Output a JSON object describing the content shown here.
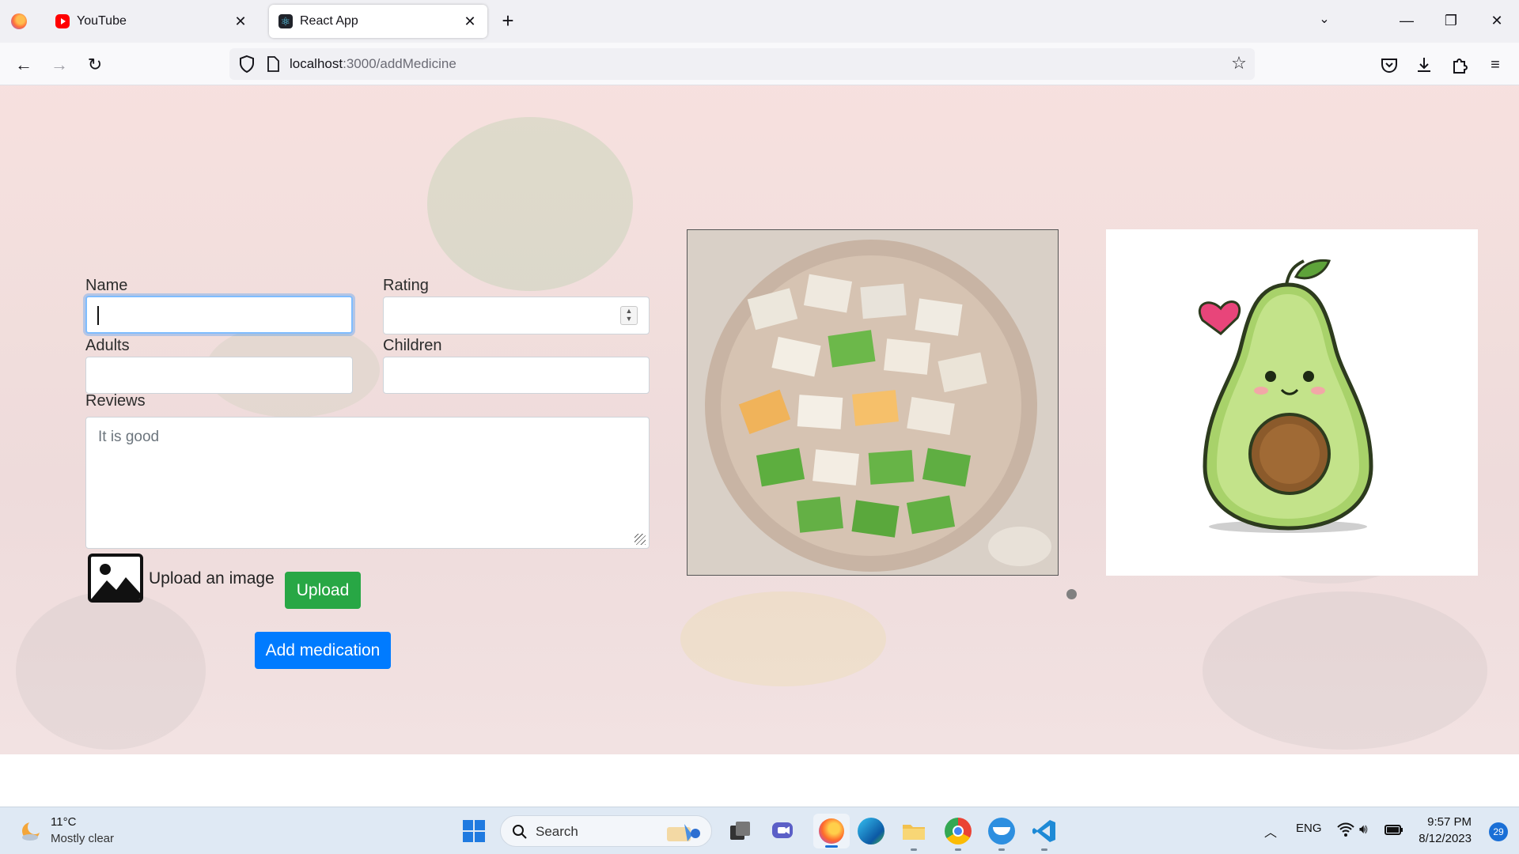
{
  "browser": {
    "tabs": [
      {
        "title": "YouTube",
        "icon": "youtube-icon",
        "active": false
      },
      {
        "title": "React App",
        "icon": "react-icon",
        "active": true
      }
    ],
    "url_host": "localhost",
    "url_path": ":3000/addMedicine"
  },
  "form": {
    "name_label": "Name",
    "name_value": "",
    "rating_label": "Rating",
    "rating_value": "",
    "adults_label": "Adults",
    "adults_value": "",
    "children_label": "Children",
    "children_value": "",
    "reviews_label": "Reviews",
    "reviews_value": "It is good",
    "upload_image_label": "Upload an image",
    "upload_button": "Upload",
    "add_button": "Add medication"
  },
  "colors": {
    "upload_button": "#28a745",
    "add_button": "#007bff",
    "focus_ring": "#80bdff"
  },
  "taskbar": {
    "weather_temp": "11°C",
    "weather_condition": "Mostly clear",
    "search_placeholder": "Search",
    "language": "ENG",
    "time": "9:57 PM",
    "date": "8/12/2023",
    "notification_count": "29"
  }
}
